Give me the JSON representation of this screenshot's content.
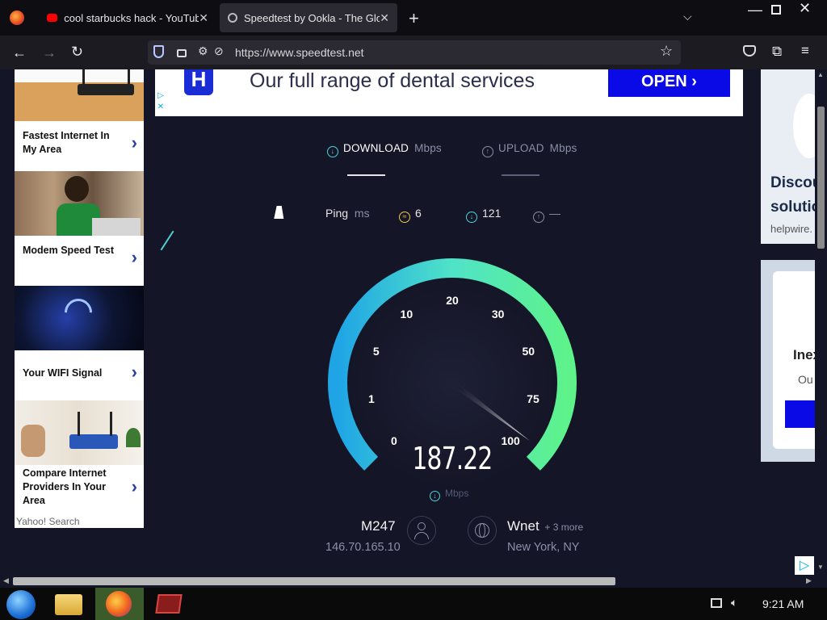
{
  "browser": {
    "tabs": [
      {
        "title": "cool starbucks hack - YouTube",
        "close": "✕"
      },
      {
        "title": "Speedtest by Ookla - The Globa",
        "close": "✕"
      }
    ],
    "new_tab": "+",
    "url": "https://www.speedtest.net"
  },
  "left_ads": {
    "items": [
      {
        "label": "Fastest Internet In My Area"
      },
      {
        "label": "Modem Speed Test"
      },
      {
        "label": "Your WIFI Signal"
      },
      {
        "label": "Compare Internet Providers In Your Area"
      }
    ],
    "chevron": "›",
    "footer": "Yahoo! Search"
  },
  "banner": {
    "logo": "H",
    "text": "Our full range of dental services",
    "cta": "OPEN  ›"
  },
  "right_ads": {
    "ad1_title_a": "Discou",
    "ad1_title_b": "solutio",
    "ad1_domain": "helpwire.",
    "ad2_title": "Inex",
    "ad2_sub": "Ou"
  },
  "speedtest": {
    "download_label": "DOWNLOAD",
    "download_unit": "Mbps",
    "upload_label": "UPLOAD",
    "upload_unit": "Mbps",
    "ping_label": "Ping",
    "ping_unit": "ms",
    "ping_value": "6",
    "download_ping": "121",
    "upload_ping": "—",
    "gauge_ticks": [
      "0",
      "1",
      "5",
      "10",
      "20",
      "30",
      "50",
      "75",
      "100"
    ],
    "speed_value": "187.22",
    "speed_unit": "Mbps",
    "host_name": "M247",
    "host_ip": "146.70.165.10",
    "isp_name": "Wnet",
    "isp_more": "+ 3 more",
    "isp_location": "New York, NY",
    "needle_fraction": 0.97
  },
  "taskbar": {
    "time": "9:21 AM"
  },
  "colors": {
    "bg": "#141526",
    "accent_cyan": "#1fb6e6",
    "accent_green": "#5ef38a"
  }
}
